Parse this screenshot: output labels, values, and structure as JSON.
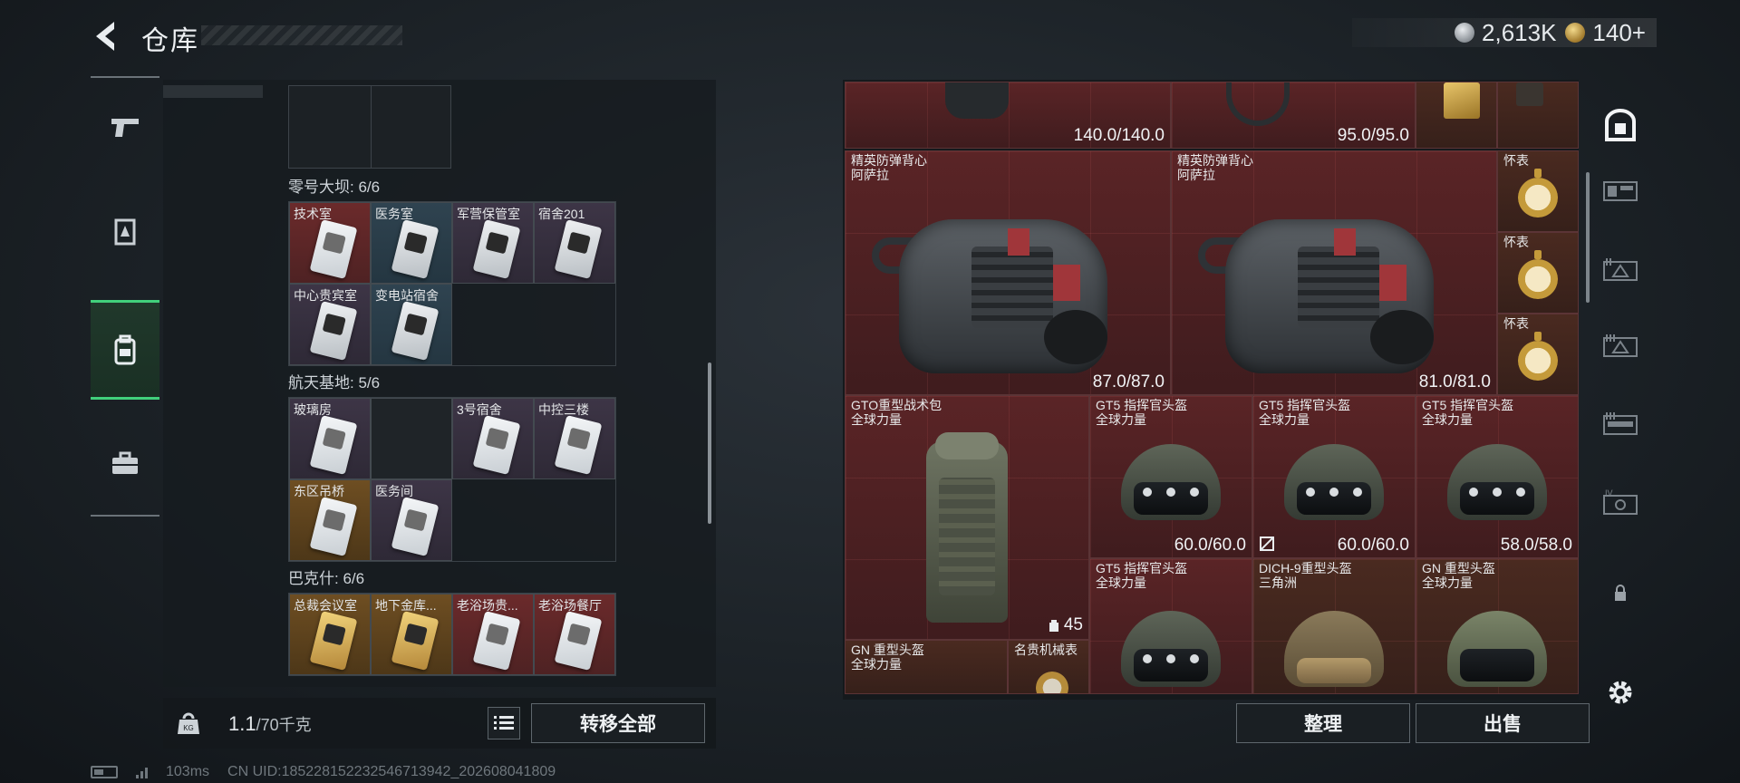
{
  "header": {
    "title": "仓库",
    "currency": [
      {
        "icon": "silver-coin-icon",
        "value": "2,613K"
      },
      {
        "icon": "gold-coin-icon",
        "value": "140+"
      }
    ]
  },
  "left_nav": {
    "items": [
      {
        "icon": "pistol-icon",
        "active": false
      },
      {
        "icon": "armor-badge-icon",
        "active": false
      },
      {
        "icon": "backpack-icon",
        "active": true
      },
      {
        "icon": "briefcase-icon",
        "active": false
      }
    ]
  },
  "stash": {
    "sections": [
      {
        "label": "零号大坝: 6/6",
        "keys": [
          {
            "name": "技术室",
            "rarity": "red"
          },
          {
            "name": "医务室",
            "rarity": "blue"
          },
          {
            "name": "军营保管室",
            "rarity": "purple"
          },
          {
            "name": "宿舍201",
            "rarity": "purple"
          },
          {
            "name": "中心贵宾室",
            "rarity": "purple"
          },
          {
            "name": "变电站宿舍",
            "rarity": "blue"
          }
        ]
      },
      {
        "label": "航天基地: 5/6",
        "keys": [
          {
            "name": "玻璃房",
            "rarity": "purple"
          },
          {
            "name": "",
            "rarity": "empty"
          },
          {
            "name": "3号宿舍",
            "rarity": "purple"
          },
          {
            "name": "中控三楼",
            "rarity": "purple"
          },
          {
            "name": "东区吊桥",
            "rarity": "gold"
          },
          {
            "name": "医务间",
            "rarity": "purple"
          }
        ]
      },
      {
        "label": "巴克什: 6/6",
        "keys": [
          {
            "name": "总裁会议室",
            "rarity": "gold"
          },
          {
            "name": "地下金库...",
            "rarity": "gold"
          },
          {
            "name": "老浴场贵...",
            "rarity": "red"
          },
          {
            "name": "老浴场餐厅",
            "rarity": "red"
          }
        ]
      }
    ]
  },
  "weight": {
    "current": "1.1",
    "capacity": "/70千克"
  },
  "buttons": {
    "transfer_all": "转移全部",
    "sort": "整理",
    "sell": "出售"
  },
  "inventory": {
    "items": [
      {
        "id": "top_a",
        "name": "",
        "sub": "",
        "durability": "140.0/140.0"
      },
      {
        "id": "top_b",
        "name": "",
        "sub": "",
        "durability": "95.0/95.0"
      },
      {
        "id": "vest_1",
        "name": "精英防弹背心",
        "sub": "阿萨拉",
        "durability": "87.0/87.0"
      },
      {
        "id": "vest_2",
        "name": "精英防弹背心",
        "sub": "阿萨拉",
        "durability": "81.0/81.0"
      },
      {
        "id": "watch_1",
        "name": "怀表",
        "sub": ""
      },
      {
        "id": "watch_2",
        "name": "怀表",
        "sub": ""
      },
      {
        "id": "watch_3",
        "name": "怀表",
        "sub": ""
      },
      {
        "id": "backpack",
        "name": "GTO重型战术包",
        "sub": "全球力量",
        "count": "45"
      },
      {
        "id": "helmet_1",
        "name": "GT5 指挥官头盔",
        "sub": "全球力量",
        "durability": "60.0/60.0"
      },
      {
        "id": "helmet_2",
        "name": "GT5 指挥官头盔",
        "sub": "全球力量",
        "durability": "60.0/60.0"
      },
      {
        "id": "helmet_3",
        "name": "GT5 指挥官头盔",
        "sub": "全球力量",
        "durability": "58.0/58.0"
      },
      {
        "id": "helmet_4",
        "name": "GT5 指挥官头盔",
        "sub": "全球力量"
      },
      {
        "id": "helmet_5",
        "name": "DICH-9重型头盔",
        "sub": "三角洲"
      },
      {
        "id": "helmet_6",
        "name": "GN 重型头盔",
        "sub": "全球力量"
      },
      {
        "id": "helmet_7",
        "name": "GN 重型头盔",
        "sub": "全球力量"
      },
      {
        "id": "wristwatch",
        "name": "名贵机械表",
        "sub": ""
      }
    ]
  },
  "right_tabs": [
    {
      "icon": "safe-box-icon",
      "active": true
    },
    {
      "icon": "stash-tab-1-icon",
      "active": false
    },
    {
      "icon": "stash-tab-2-icon",
      "active": false
    },
    {
      "icon": "stash-tab-3-icon",
      "active": false
    },
    {
      "icon": "stash-tab-4-icon",
      "active": false
    },
    {
      "icon": "stash-tab-5-icon",
      "active": false
    },
    {
      "icon": "lock-icon",
      "active": false
    },
    {
      "icon": "settings-icon",
      "active": false
    }
  ],
  "status": {
    "ping": "103ms",
    "uid": "CN UID:185228152232546713942_202608041809"
  },
  "colors": {
    "active_green": "#41d07b",
    "rarity_red": "#5a2426",
    "rarity_gold": "#6e4e22",
    "rarity_purple": "#3d3546",
    "rarity_blue": "#2f4350"
  }
}
